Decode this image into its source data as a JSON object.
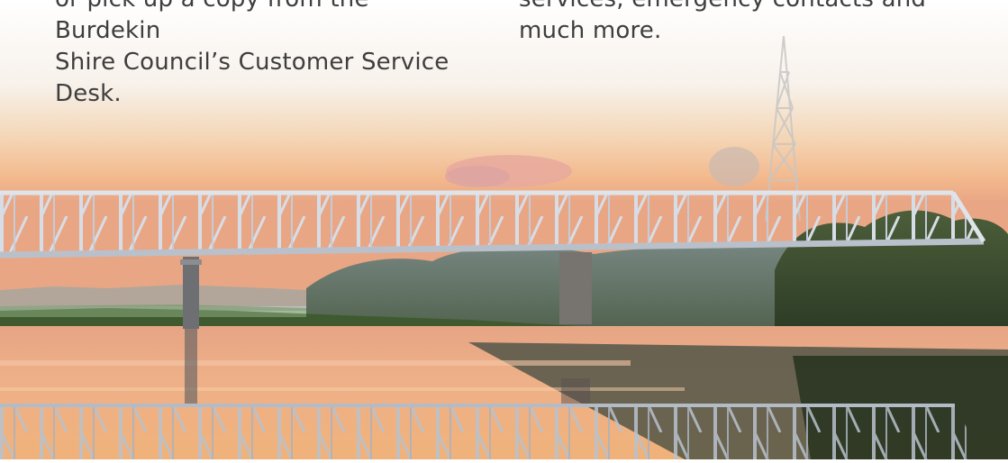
{
  "left_column": {
    "line1": "or pick up a copy from the Burdekin",
    "line2": "Shire Council’s Customer Service",
    "line3": "Desk."
  },
  "right_column": {
    "line1": "services, emergency contacts and",
    "line2": "much more."
  },
  "photo": {
    "subject": "bridge-over-river-at-sunset"
  },
  "colors": {
    "text": "#3e3e3e",
    "sky_top": "#f3ede6",
    "sky_glow": "#f6c79a",
    "water": "#e9a276",
    "truss": "#cfd6e0"
  }
}
